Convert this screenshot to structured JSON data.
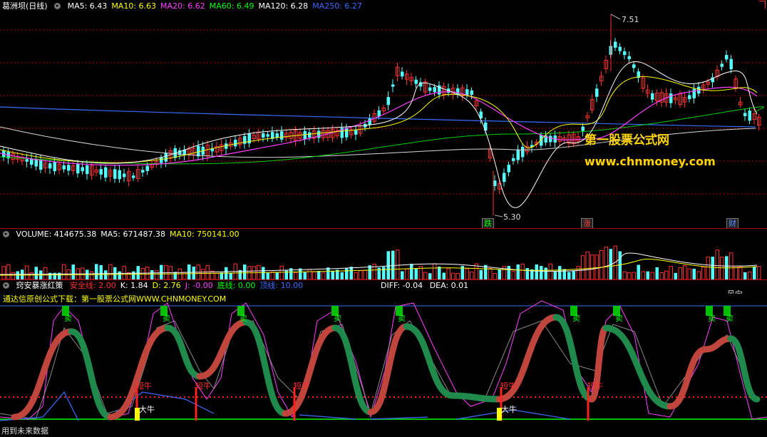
{
  "main_panel": {
    "title": "葛洲坝(日线)",
    "indicators": [
      {
        "label": "MA5: 6.43",
        "color": "#ffffff"
      },
      {
        "label": "MA10: 6.63",
        "color": "#ffff00"
      },
      {
        "label": "MA20: 6.62",
        "color": "#ff40ff"
      },
      {
        "label": "MA60: 6.49",
        "color": "#00ff00"
      },
      {
        "label": "MA120: 6.28",
        "color": "#ffffff"
      },
      {
        "label": "MA250: 6.27",
        "color": "#3a6bff"
      }
    ],
    "high_label": "7.51",
    "low_label": "5.30",
    "markers": [
      {
        "text": "跌",
        "color": "#00ff00"
      },
      {
        "text": "涨",
        "color": "#ff4040"
      },
      {
        "text": "财",
        "color": "#5c8cff"
      }
    ]
  },
  "watermark": {
    "line1": "第一股票公式网",
    "line2": "www.chnmoney.com"
  },
  "volume_panel": {
    "indicators": [
      {
        "label": "VOLUME: 414675.38",
        "color": "#ffffff"
      },
      {
        "label": "MA5: 671487.38",
        "color": "#ffffff"
      },
      {
        "label": "MA10: 750141.00",
        "color": "#ffff00"
      }
    ]
  },
  "indicator_panel": {
    "name": "窍安暴涨红策",
    "values": [
      {
        "label": "安全线: 2.00",
        "color": "#ff3030"
      },
      {
        "label": "K: 1.84",
        "color": "#ffffff"
      },
      {
        "label": "D: 2.76",
        "color": "#ffff00"
      },
      {
        "label": "J: -0.00",
        "color": "#ff40ff"
      },
      {
        "label": "底线: 0.00",
        "color": "#00ff00"
      },
      {
        "label": "顶线: 10.00",
        "color": "#3a6bff"
      }
    ],
    "diff": "DIFF: -0.04",
    "dea": "DEA: 0.01",
    "subtitle": "通达信原创公式下载：第一股票公式网WWW.CHNMONEY.COM",
    "corner": "风向",
    "sell_label": "卖",
    "short_bull_label": "短牛",
    "big_bull_label": "大牛",
    "footer": "用到未来数据"
  }
}
